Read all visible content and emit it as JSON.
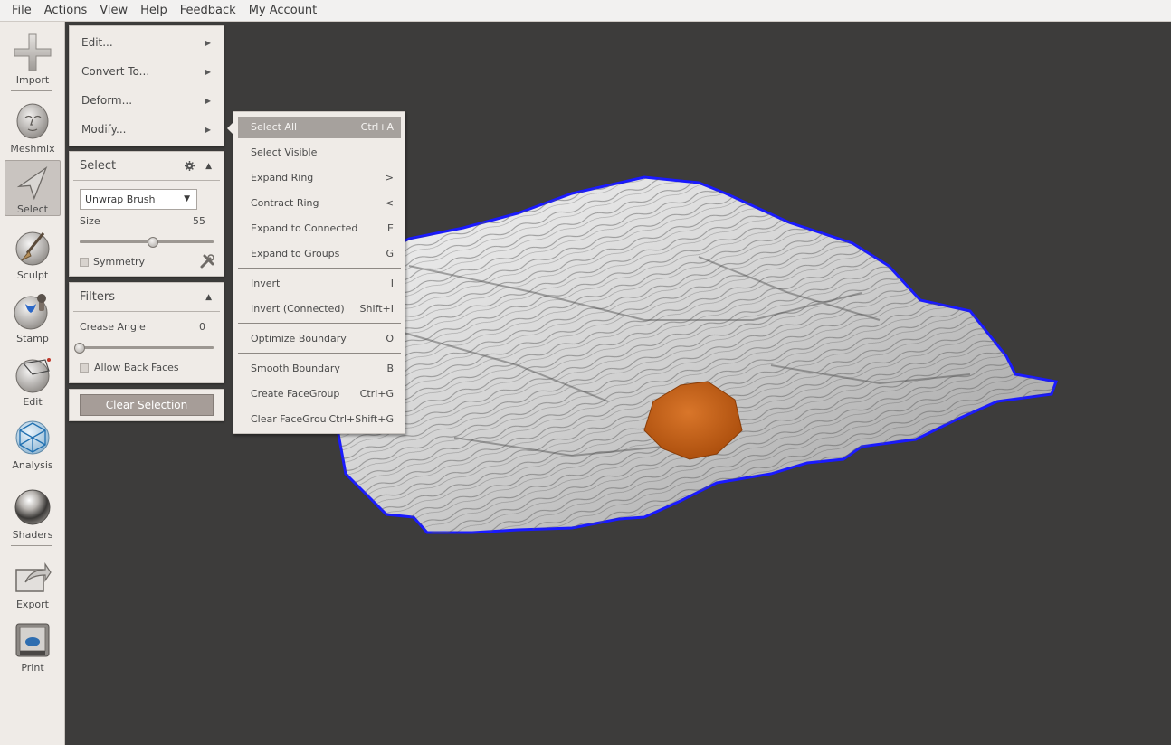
{
  "menubar": {
    "items": [
      "File",
      "Actions",
      "View",
      "Help",
      "Feedback",
      "My Account"
    ]
  },
  "toolbar": {
    "items": [
      {
        "label": "Import",
        "icon": "plus-icon"
      },
      {
        "label": "Meshmix",
        "icon": "meshmix-head-icon"
      },
      {
        "label": "Select",
        "icon": "select-arrow-icon",
        "active": true
      },
      {
        "label": "Sculpt",
        "icon": "sculpt-brush-icon"
      },
      {
        "label": "Stamp",
        "icon": "stamp-icon"
      },
      {
        "label": "Edit",
        "icon": "edit-sphere-icon"
      },
      {
        "label": "Analysis",
        "icon": "analysis-mesh-icon"
      },
      {
        "label": "Shaders",
        "icon": "shader-sphere-icon"
      },
      {
        "label": "Export",
        "icon": "export-icon"
      },
      {
        "label": "Print",
        "icon": "printer-icon"
      }
    ]
  },
  "menu_panel": {
    "items": [
      "Edit...",
      "Convert To...",
      "Deform...",
      "Modify..."
    ]
  },
  "select_panel": {
    "title": "Select",
    "brush": "Unwrap Brush",
    "size_label": "Size",
    "size_value": "55",
    "size_fraction": 0.55,
    "symmetry_label": "Symmetry"
  },
  "filters_panel": {
    "title": "Filters",
    "crease_label": "Crease Angle",
    "crease_value": "0",
    "crease_fraction": 0.0,
    "back_faces_label": "Allow Back Faces"
  },
  "clear_button": "Clear Selection",
  "submenu": {
    "items": [
      {
        "label": "Select All",
        "shortcut": "Ctrl+A",
        "highlighted": true
      },
      {
        "label": "Select Visible",
        "shortcut": ""
      },
      {
        "label": "Expand Ring",
        "shortcut": ">"
      },
      {
        "label": "Contract Ring",
        "shortcut": "<"
      },
      {
        "label": "Expand to Connected",
        "shortcut": "E"
      },
      {
        "label": "Expand to Groups",
        "shortcut": "G"
      },
      {
        "label": "Invert",
        "shortcut": "I"
      },
      {
        "label": "Invert (Connected)",
        "shortcut": "Shift+I"
      },
      {
        "label": "Optimize Boundary",
        "shortcut": "O"
      },
      {
        "label": "Smooth Boundary",
        "shortcut": "B"
      },
      {
        "label": "Create FaceGroup",
        "shortcut": "Ctrl+G"
      },
      {
        "label": "Clear FaceGroups",
        "shortcut": "Ctrl+Shift+G"
      }
    ]
  },
  "colors": {
    "viewport_bg": "#3d3c3b",
    "selection_orange": "#c8600f",
    "boundary_blue": "#1a1aff",
    "menu_highlight": "#a6a19d"
  }
}
